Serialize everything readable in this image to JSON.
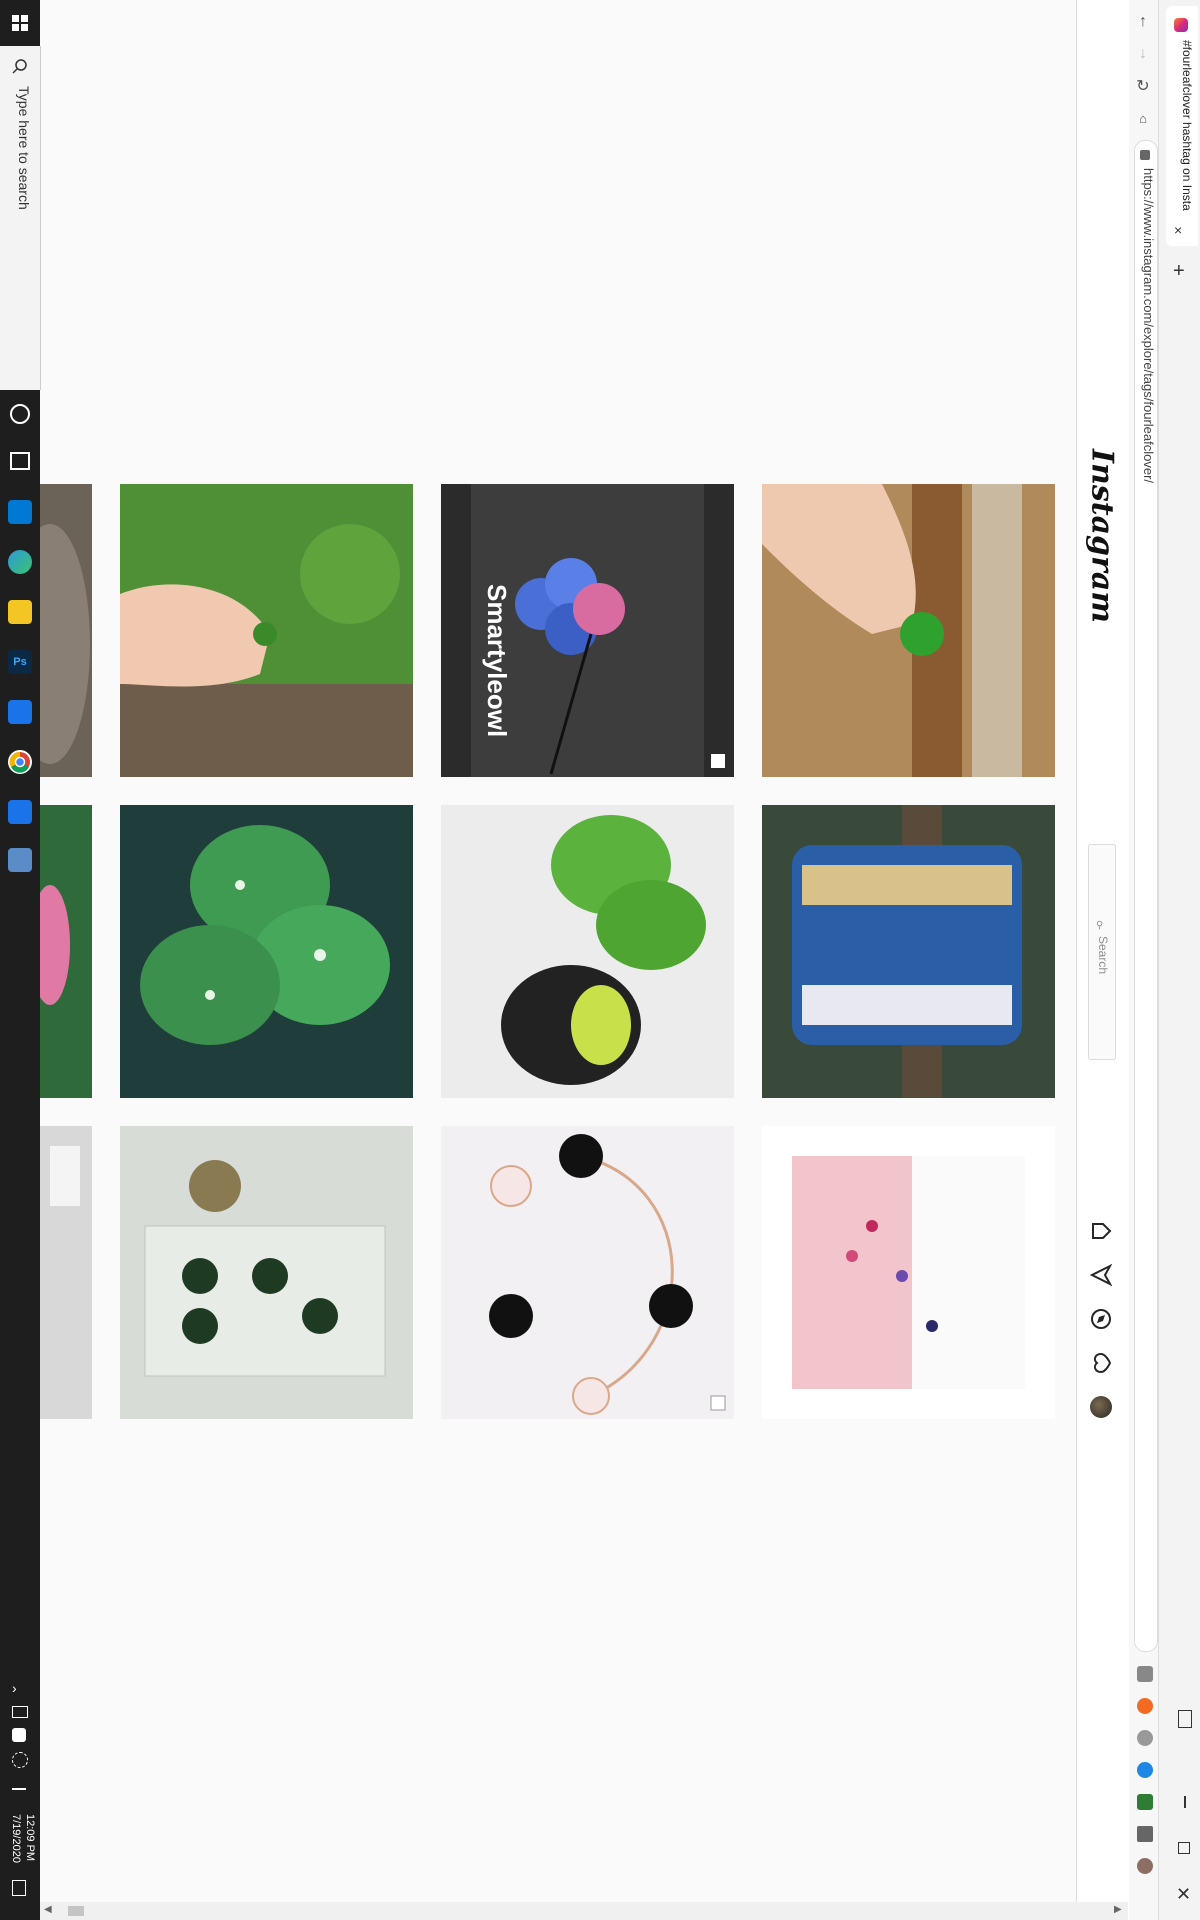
{
  "taskbar": {
    "search_placeholder": "Type here to search",
    "time": "12:09 PM",
    "date": "7/19/2020",
    "app_icons": [
      "ms-store-icon",
      "edge-icon",
      "sticky-notes-icon",
      "photoshop-icon",
      "app-blue-icon",
      "chrome-icon",
      "settings-app-icon",
      "control-panel-icon"
    ],
    "ps_label": "Ps"
  },
  "browser": {
    "tab_title": "#fourleafclover hashtag on Insta",
    "url": "https://www.instagram.com/explore/tags/fourleafclover/",
    "new_tab": "+",
    "close_tab": "×"
  },
  "instagram": {
    "logo": "Instagram",
    "search_placeholder": "Search",
    "nav_icons": [
      "home-icon",
      "direct-icon",
      "explore-icon",
      "activity-heart-icon",
      "profile-avatar"
    ]
  },
  "grid": {
    "captions": {
      "smartyleowl": "Smartyleowl"
    },
    "tiles": [
      {
        "name": "post-hand-clover-grass"
      },
      {
        "name": "post-blue-clover-smartyleowl"
      },
      {
        "name": "post-hand-clover-bricks"
      },
      {
        "name": "post-clover-water-drops"
      },
      {
        "name": "post-figurine-clover"
      },
      {
        "name": "post-beaded-bracelets"
      },
      {
        "name": "post-pressed-clovers-bag"
      },
      {
        "name": "post-clover-bracelet"
      },
      {
        "name": "post-clover-shirt"
      }
    ]
  },
  "colors": {
    "taskbar_bg": "#1e1e1e",
    "page_bg": "#fafafa",
    "border": "#dbdbdb"
  }
}
